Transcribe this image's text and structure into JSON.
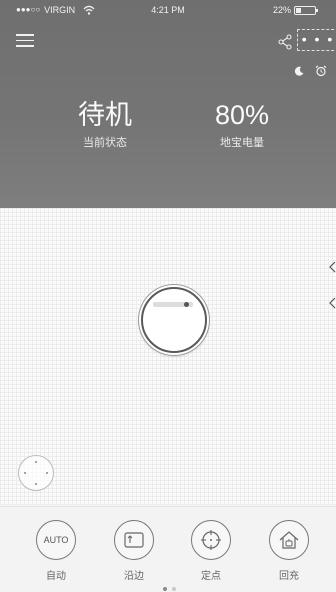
{
  "status_bar": {
    "carrier": "VIRGIN",
    "signal_dots": "●●●○○",
    "time": "4:21 PM",
    "battery": "22%",
    "battery_level": 0.22
  },
  "toolbar": {
    "more_label": "• • •",
    "icons": [
      "menu-icon",
      "share-icon",
      "more-icon",
      "moon-icon",
      "alarm-icon"
    ]
  },
  "stats": [
    {
      "value": "待机",
      "label": "当前状态"
    },
    {
      "value": "80%",
      "label": "地宝电量"
    }
  ],
  "modes": [
    {
      "icon_text": "AUTO",
      "label": "自动"
    },
    {
      "icon_text": "",
      "label": "沿边"
    },
    {
      "icon_text": "",
      "label": "定点"
    },
    {
      "icon_text": "",
      "label": "回充"
    }
  ],
  "pager": {
    "pages": 2,
    "current": 1
  },
  "colors": {
    "header": "#757575",
    "map_bg": "#fbfbfb",
    "bottom_bar": "#f3f3f3"
  }
}
